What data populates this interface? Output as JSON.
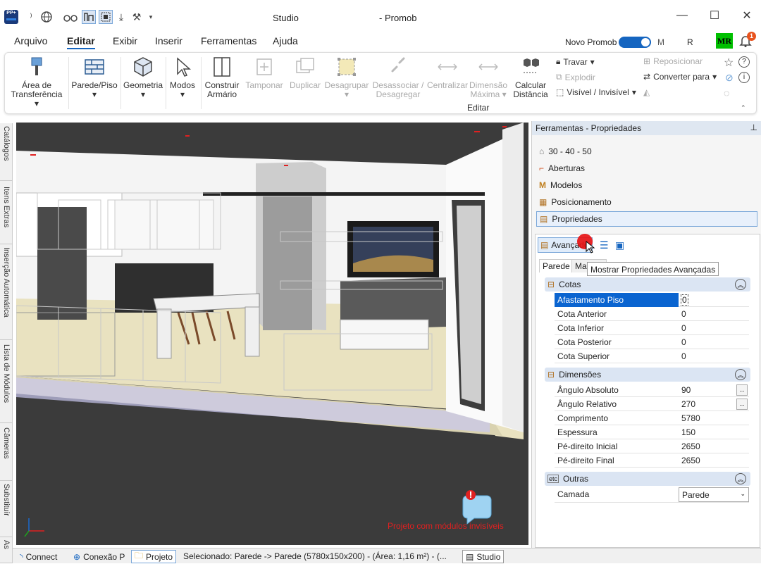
{
  "title": {
    "left": "Studio",
    "right": "- Promob"
  },
  "menu": [
    "Arquivo",
    "Editar",
    "Exibir",
    "Inserir",
    "Ferramentas",
    "Ajuda"
  ],
  "account": {
    "novo_promob": "Novo Promob",
    "m": "M",
    "r": "R",
    "initials": "MR",
    "notifications": "1"
  },
  "ribbon": {
    "area_transferencia": "Área de\nTransferência",
    "parede_piso": "Parede/Piso",
    "geometria": "Geometria",
    "modos": "Modos",
    "construir_armario": "Construir\nArmário",
    "tamponar": "Tamponar",
    "duplicar": "Duplicar",
    "desagrupar": "Desagrupar",
    "desassociar": "Desassociar /\nDesagregar",
    "centralizar": "Centralizar",
    "dimensao_maxima": "Dimensão\nMáxima",
    "calcular_distancia": "Calcular\nDistância",
    "editar_group": "Editar",
    "travar": "Travar",
    "explodir": "Explodir",
    "visivel_invisivel": "Visível / Invisível",
    "reposicionar": "Reposicionar",
    "converter_para": "Converter para"
  },
  "left_tabs": [
    "Catálogos",
    "Itens Extras",
    "Inserção Automática",
    "Lista de Módulos",
    "Câmeras",
    "Substituir",
    "As"
  ],
  "viewport": {
    "warning_text": "Projeto com módulos invisíveis"
  },
  "status": {
    "connect": "Connect",
    "conexao": "Conexão P",
    "projeto": "Projeto",
    "selection": "Selecionado: Parede -> Parede (5780x150x200) - (Área: 1,16 m²) - (...",
    "studio": "Studio"
  },
  "panel": {
    "title": "Ferramentas - Propriedades",
    "items": [
      "30 - 40 - 50",
      "Aberturas",
      "Modelos",
      "Posicionamento",
      "Propriedades"
    ],
    "advanced_button": "Avançado",
    "tabs": [
      "Parede",
      "Ma"
    ],
    "tooltip": "Mostrar Propriedades Avançadas",
    "groups": [
      {
        "label": "Cotas",
        "rows": [
          {
            "name": "Afastamento Piso",
            "value": "0"
          },
          {
            "name": "Cota Anterior",
            "value": "0"
          },
          {
            "name": "Cota Inferior",
            "value": "0"
          },
          {
            "name": "Cota Posterior",
            "value": "0"
          },
          {
            "name": "Cota Superior",
            "value": "0"
          }
        ]
      },
      {
        "label": "Dimensões",
        "rows": [
          {
            "name": "Ângulo Absoluto",
            "value": "90"
          },
          {
            "name": "Ângulo Relativo",
            "value": "270"
          },
          {
            "name": "Comprimento",
            "value": "5780"
          },
          {
            "name": "Espessura",
            "value": "150"
          },
          {
            "name": "Pé-direito Inicial",
            "value": "2650"
          },
          {
            "name": "Pé-direito Final",
            "value": "2650"
          }
        ]
      },
      {
        "label": "Outras",
        "rows": [
          {
            "name": "Camada",
            "value": "Parede"
          }
        ]
      }
    ]
  },
  "colors": {
    "accent": "#1565c0",
    "selection": "#0a64d0",
    "group_header": "#dbe5f3",
    "warning": "#e02020",
    "badge": "#e8531e",
    "avatar": "#00c000"
  }
}
